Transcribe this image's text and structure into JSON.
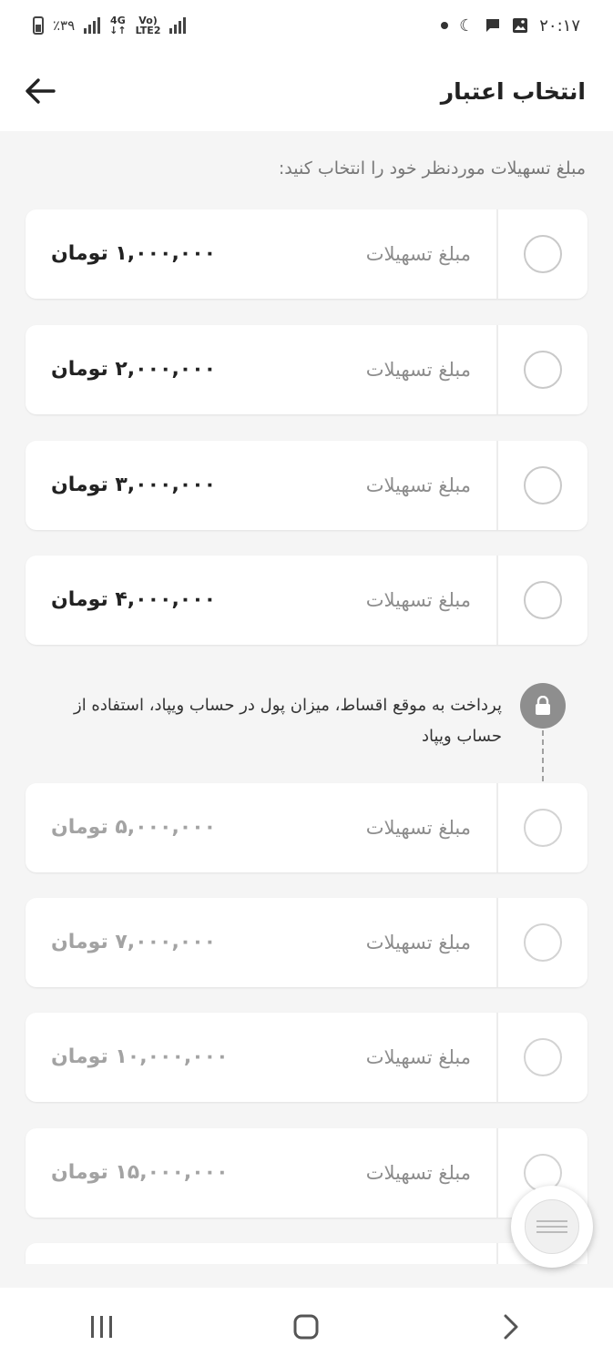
{
  "status_bar": {
    "time": "۲۰:۱۷",
    "battery": "٪۳۹",
    "network_type": "4G",
    "volte": "Vo)",
    "lte": "LTE2"
  },
  "header": {
    "title": "انتخاب اعتبار",
    "back_icon": "arrow-left-icon"
  },
  "instruction": "مبلغ تسهیلات موردنظر خود را انتخاب کنید:",
  "available_options": [
    {
      "label": "مبلغ تسهیلات",
      "amount": "۱,۰۰۰,۰۰۰ تومان"
    },
    {
      "label": "مبلغ تسهیلات",
      "amount": "۲,۰۰۰,۰۰۰ تومان"
    },
    {
      "label": "مبلغ تسهیلات",
      "amount": "۳,۰۰۰,۰۰۰ تومان"
    },
    {
      "label": "مبلغ تسهیلات",
      "amount": "۴,۰۰۰,۰۰۰ تومان"
    }
  ],
  "lock_notice": {
    "icon": "lock-icon",
    "text": "پرداخت به موقع اقساط، میزان پول در حساب ویپاد، استفاده از حساب ویپاد"
  },
  "locked_options": [
    {
      "label": "مبلغ تسهیلات",
      "amount": "۵,۰۰۰,۰۰۰ تومان"
    },
    {
      "label": "مبلغ تسهیلات",
      "amount": "۷,۰۰۰,۰۰۰ تومان"
    },
    {
      "label": "مبلغ تسهیلات",
      "amount": "۱۰,۰۰۰,۰۰۰ تومان"
    },
    {
      "label": "مبلغ تسهیلات",
      "amount": "۱۵,۰۰۰,۰۰۰ تومان"
    }
  ],
  "colors": {
    "background": "#f5f5f5",
    "card": "#ffffff",
    "text_primary": "#222222",
    "text_secondary": "#8d8d8d",
    "text_locked": "#a3a3a3",
    "lock_badge": "#8e8e8e"
  }
}
